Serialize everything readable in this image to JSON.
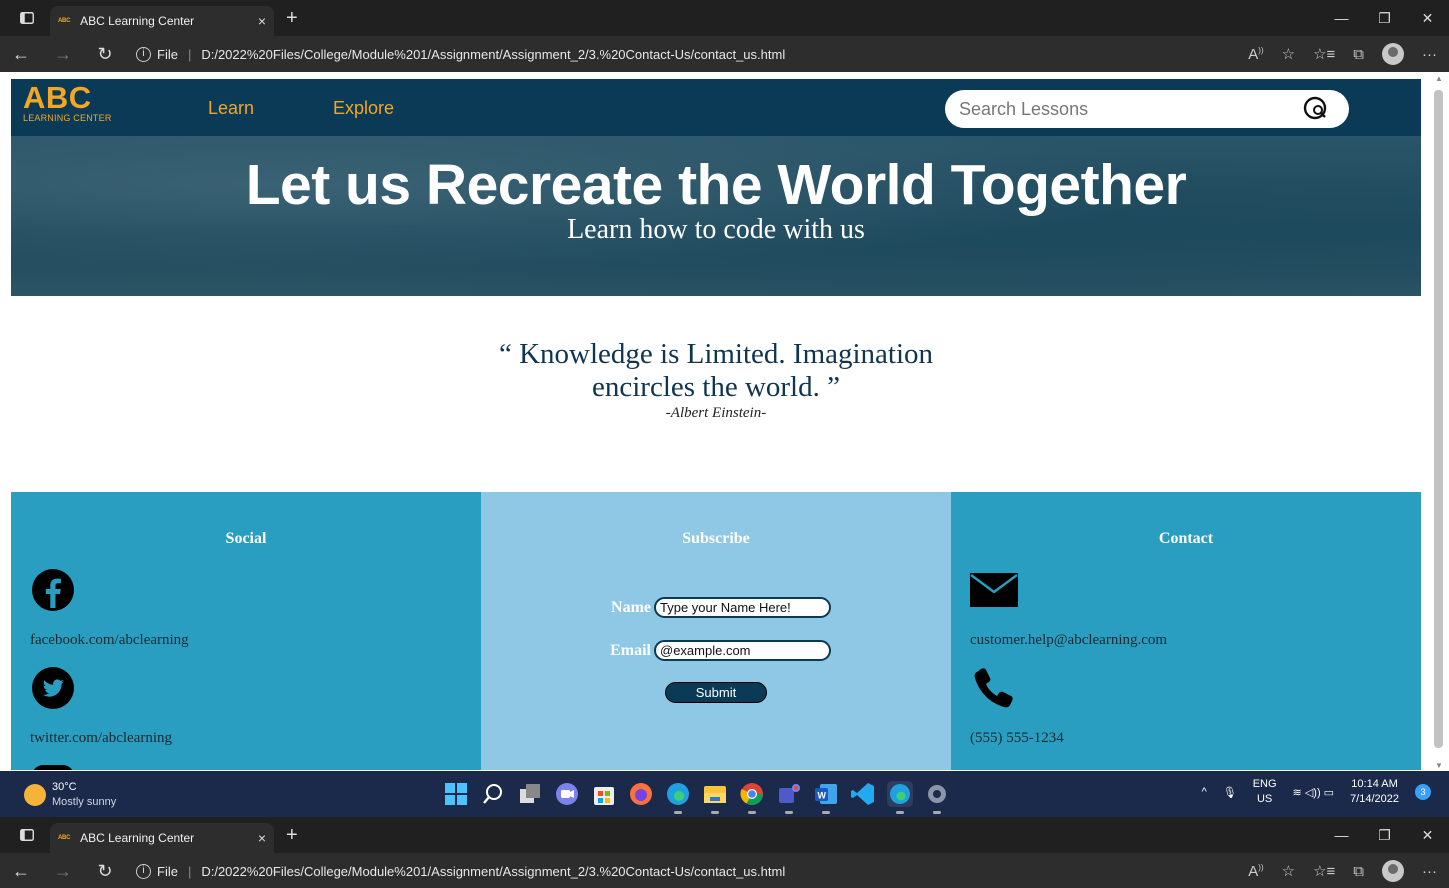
{
  "browser": {
    "tab_title": "ABC Learning Center",
    "tab_favicon": "ABC",
    "tab_close": "×",
    "new_tab": "+",
    "file_label": "File",
    "url": "D:/2022%20Files/College/Module%201/Assignment/Assignment_2/3.%20Contact-Us/contact_us.html"
  },
  "site": {
    "logo_main": "ABC",
    "logo_sub": "LEARNING CENTER",
    "nav": [
      "Learn",
      "Explore"
    ],
    "search_placeholder": "Search Lessons",
    "hero_title": "Let us Recreate the World Together",
    "hero_subtitle": "Learn how to code with us",
    "quote_line1": "“ Knowledge is Limited. Imagination",
    "quote_line2": "encircles the world. ”",
    "quote_author": "-Albert Einstein-"
  },
  "footer": {
    "social": {
      "heading": "Social",
      "facebook": "facebook.com/abclearning",
      "twitter": "twitter.com/abclearning"
    },
    "subscribe": {
      "heading": "Subscribe",
      "name_label": "Name",
      "name_value": "Type your Name Here!",
      "email_label": "Email",
      "email_value": "@example.com",
      "submit": "Submit"
    },
    "contact": {
      "heading": "Contact",
      "email": "customer.help@abclearning.com",
      "phone": "(555) 555-1234"
    }
  },
  "taskbar": {
    "temp": "30°C",
    "weather": "Mostly sunny",
    "lang_top": "ENG",
    "lang_bottom": "US",
    "time": "10:14 AM",
    "date": "7/14/2022",
    "notifications": "3",
    "apps": [
      "windows-start",
      "search",
      "task-view",
      "chat",
      "store",
      "firefox",
      "edge",
      "file-explorer",
      "chrome",
      "teams",
      "word",
      "vscode",
      "edge-active",
      "settings"
    ]
  },
  "colors": {
    "header_bg": "#0a3a55",
    "accent_orange": "#f5a623",
    "footer_blue": "#2a9ec1",
    "footer_light": "#8fc8e4"
  }
}
